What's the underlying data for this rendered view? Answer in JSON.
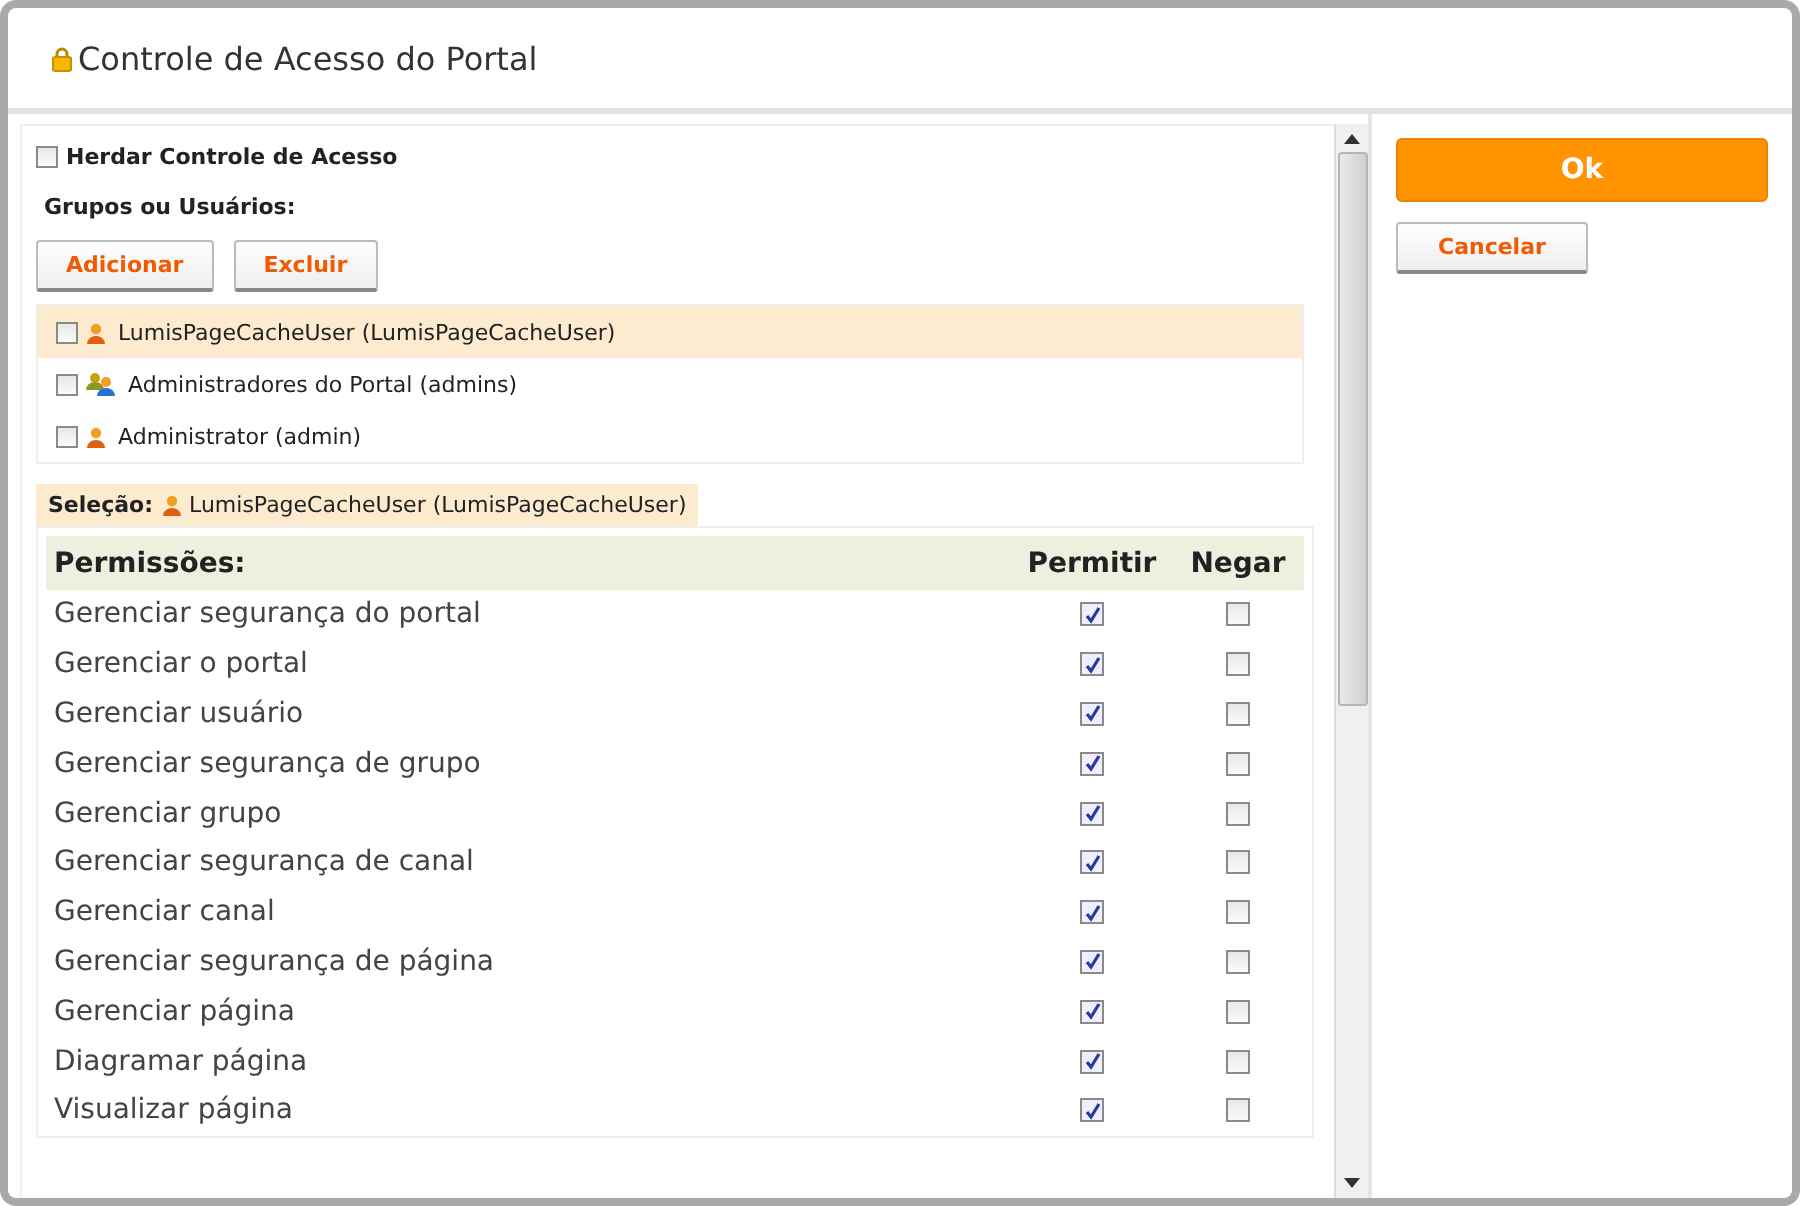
{
  "window": {
    "title": "Controle de Acesso do Portal"
  },
  "inherit": {
    "label": "Herdar Controle de Acesso",
    "checked": false
  },
  "groups_label": "Grupos ou Usuários:",
  "actions": [
    "Adicionar",
    "Excluir"
  ],
  "members": [
    {
      "label": "LumisPageCacheUser (LumisPageCacheUser)",
      "kind": "user",
      "checked": false,
      "selected": true
    },
    {
      "label": "Administradores do Portal (admins)",
      "kind": "group",
      "checked": false,
      "selected": false
    },
    {
      "label": "Administrator (admin)",
      "kind": "user",
      "checked": false,
      "selected": false
    }
  ],
  "selection": {
    "label": "Seleção:",
    "kind": "user",
    "value": "LumisPageCacheUser (LumisPageCacheUser)"
  },
  "permissions": {
    "columns": [
      "Permissões:",
      "Permitir",
      "Negar"
    ],
    "rows": [
      {
        "name": "Gerenciar segurança do portal",
        "allow": true,
        "deny": false
      },
      {
        "name": "Gerenciar o portal",
        "allow": true,
        "deny": false
      },
      {
        "name": "Gerenciar usuário",
        "allow": true,
        "deny": false
      },
      {
        "name": "Gerenciar segurança de grupo",
        "allow": true,
        "deny": false
      },
      {
        "name": "Gerenciar grupo",
        "allow": true,
        "deny": false
      },
      {
        "name": "Gerenciar segurança de canal",
        "allow": true,
        "deny": false
      },
      {
        "name": "Gerenciar canal",
        "allow": true,
        "deny": false
      },
      {
        "name": "Gerenciar segurança de página",
        "allow": true,
        "deny": false
      },
      {
        "name": "Gerenciar página",
        "allow": true,
        "deny": false
      },
      {
        "name": "Diagramar página",
        "allow": true,
        "deny": false
      },
      {
        "name": "Visualizar página",
        "allow": true,
        "deny": false
      }
    ]
  },
  "buttons": {
    "ok": "Ok",
    "cancel": "Cancelar"
  }
}
